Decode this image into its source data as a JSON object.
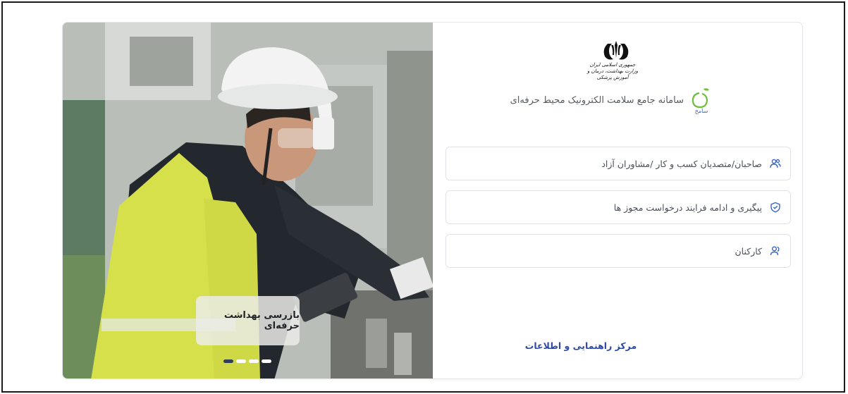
{
  "hero": {
    "caption": "بازرسی بهداشت حرفه‌ای",
    "slides_count": 4,
    "active_slide": 1
  },
  "brand": {
    "ministry_lines": [
      "جمهوری اسلامی ایران",
      "وزارت بهداشت، درمان و آموزش پزشکی"
    ],
    "system_title": "سامانه جامع سلامت الکترونیک محیط حرفه‌ای",
    "logo_text": "سامح"
  },
  "options": [
    {
      "label": "صاحبان/متصدیان کسب و کار /مشاوران آزاد",
      "icon": "users-icon"
    },
    {
      "label": "پیگیری و ادامه فرایند درخواست مجوز ها",
      "icon": "shield-check-icon"
    },
    {
      "label": "کارکنان",
      "icon": "user-group-icon"
    }
  ],
  "help": {
    "label": "مرکز راهنمایی و اطلاعات"
  },
  "colors": {
    "accent": "#3b66c4",
    "link": "#2f4aa6",
    "logo_green": "#6cbf3a"
  }
}
